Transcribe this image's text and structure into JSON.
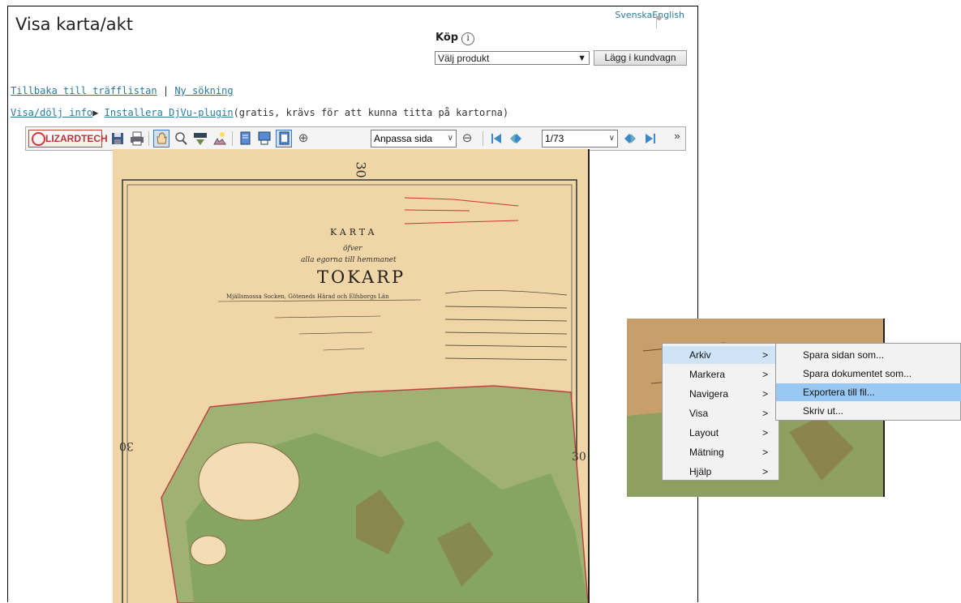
{
  "page": {
    "title": "Visa karta/akt",
    "languages": [
      "Svenska",
      "English"
    ],
    "buy_label": "Köp",
    "buy_info_icon": "i",
    "product_select_value": "Välj produkt",
    "add_to_cart_label": "Lägg i kundvagn"
  },
  "links": {
    "back_to_results": "Tillbaka till träfflistan",
    "separator": "|",
    "new_search": "Ny sökning",
    "toggle_info": "Visa/dölj info",
    "install_plugin": "Installera DjVu-plugin",
    "install_note": "(gratis, krävs för att kunna titta på kartorna)"
  },
  "toolbar": {
    "logo": "LIZARDTECH",
    "zoom_value": "Anpassa sida",
    "page_value": "1/73",
    "more": "»",
    "icons": [
      "save-icon",
      "print-icon",
      "hand-tool-icon",
      "zoom-tool-icon",
      "text-select-icon",
      "annotate-icon",
      "single-page-icon",
      "continuous-icon",
      "fit-page-icon",
      "zoom-in-icon",
      "zoom-out-icon",
      "first-page-icon",
      "prev-page-icon",
      "next-page-icon",
      "last-page-icon"
    ]
  },
  "map": {
    "page_number": "30",
    "heading": "KARTA",
    "sub1": "öfver",
    "sub2": "alla egorna till hemmanet",
    "name": "TOKARP",
    "region": "Mjällsmossa Socken, Göteneds Härad och Elfsborgs Län",
    "edge_number": "30"
  },
  "context_menu": {
    "items": [
      {
        "label": "Arkiv",
        "highlighted": true
      },
      {
        "label": "Markera",
        "highlighted": false
      },
      {
        "label": "Navigera",
        "highlighted": false
      },
      {
        "label": "Visa",
        "highlighted": false
      },
      {
        "label": "Layout",
        "highlighted": false
      },
      {
        "label": "Mätning",
        "highlighted": false
      },
      {
        "label": "Hjälp",
        "highlighted": false
      }
    ],
    "arrow": ">",
    "submenu": [
      {
        "label": "Spara sidan som...",
        "highlighted": false
      },
      {
        "label": "Spara dokumentet som...",
        "highlighted": false
      },
      {
        "label": "Exportera till fil...",
        "highlighted": true
      },
      {
        "label": "Skriv ut...",
        "highlighted": false
      }
    ]
  },
  "colors": {
    "link": "#2a7b9b",
    "parchment": "#f0d6a6",
    "forest": "#7ea05e",
    "menu_highlight": "#99c9f2"
  }
}
